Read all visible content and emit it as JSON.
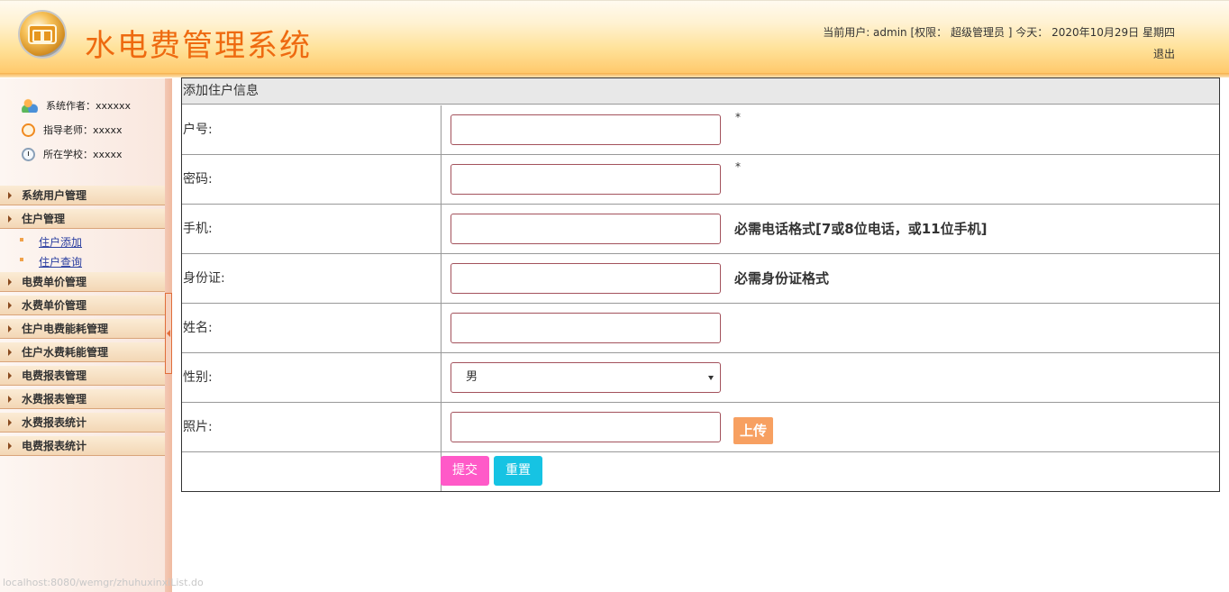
{
  "header": {
    "title": "水电费管理系统",
    "user_info": "当前用户: admin [权限： 超级管理员 ] 今天： 2020年10月29日 星期四",
    "logout": "退出"
  },
  "sidebar": {
    "info": [
      {
        "icon": "users-icon",
        "text": "系统作者：xxxxxx"
      },
      {
        "icon": "alarm-icon",
        "text": "指导老师：xxxxx"
      },
      {
        "icon": "clock-icon",
        "text": "所在学校：xxxxx"
      }
    ],
    "menu": [
      {
        "label": "系统用户管理"
      },
      {
        "label": "住户管理",
        "children": [
          "住户添加",
          "住户查询"
        ]
      },
      {
        "label": "电费单价管理"
      },
      {
        "label": "水费单价管理"
      },
      {
        "label": "住户电费能耗管理"
      },
      {
        "label": "住户水费耗能管理"
      },
      {
        "label": "电费报表管理"
      },
      {
        "label": "水费报表管理"
      },
      {
        "label": "水费报表统计"
      },
      {
        "label": "电费报表统计"
      }
    ]
  },
  "status_url": "localhost:8080/wemgr/zhuhuxinxiList.do",
  "form": {
    "title": "添加住户信息",
    "fields": [
      {
        "label": "户号:",
        "value": "",
        "note": "*"
      },
      {
        "label": "密码:",
        "value": "",
        "note": "*"
      },
      {
        "label": "手机:",
        "value": "",
        "hint": "必需电话格式[7或8位电话，或11位手机]"
      },
      {
        "label": "身份证:",
        "value": "",
        "hint": "必需身份证格式"
      },
      {
        "label": "姓名:",
        "value": ""
      },
      {
        "label": "性别:",
        "value": "男"
      },
      {
        "label": "照片:",
        "value": "",
        "button": "上传"
      }
    ],
    "submit": "提交",
    "reset": "重置"
  },
  "colors": {
    "title": "#ee6a10",
    "submit_button": "#ff5ac8",
    "reset_button": "#16c3e3",
    "upload_button": "#f7a061",
    "input_border": "#a3525c"
  }
}
